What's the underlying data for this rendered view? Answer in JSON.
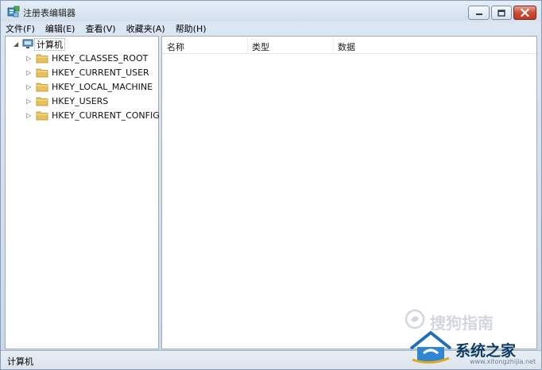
{
  "window": {
    "title": "注册表编辑器"
  },
  "menu": {
    "items": [
      {
        "label": "文件(F)"
      },
      {
        "label": "编辑(E)"
      },
      {
        "label": "查看(V)"
      },
      {
        "label": "收藏夹(A)"
      },
      {
        "label": "帮助(H)"
      }
    ]
  },
  "tree": {
    "root_label": "计算机",
    "keys": [
      {
        "label": "HKEY_CLASSES_ROOT"
      },
      {
        "label": "HKEY_CURRENT_USER"
      },
      {
        "label": "HKEY_LOCAL_MACHINE"
      },
      {
        "label": "HKEY_USERS"
      },
      {
        "label": "HKEY_CURRENT_CONFIG"
      }
    ]
  },
  "list": {
    "columns": [
      {
        "label": "名称"
      },
      {
        "label": "类型"
      },
      {
        "label": "数据"
      }
    ]
  },
  "status": {
    "path": "计算机"
  },
  "watermark": {
    "site_name": "系统之家",
    "site_url": "www.xitongzhijia.net",
    "sogou": "搜狗指南"
  },
  "colors": {
    "title_gradient_top": "#e4edf7",
    "close_button": "#c23a22",
    "folder": "#e8c15a",
    "pane_border": "#a0abb8"
  }
}
